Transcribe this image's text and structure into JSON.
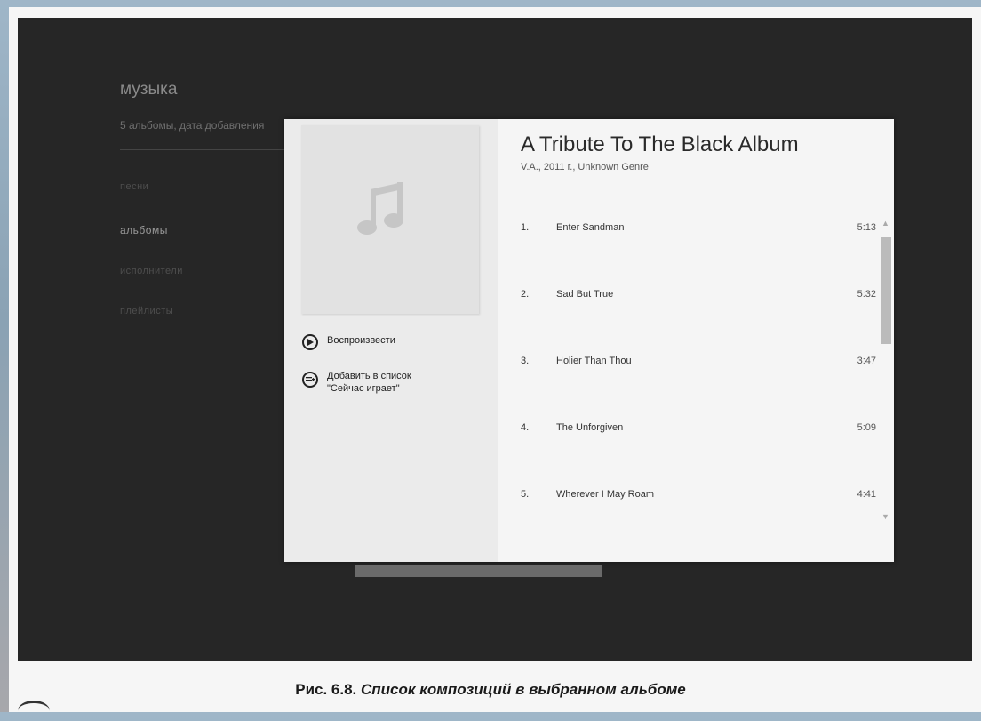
{
  "app": {
    "title": "музыка",
    "subtitle": "5 альбомы, дата добавления"
  },
  "nav": {
    "items": [
      {
        "label": "песни",
        "active": false
      },
      {
        "label": "альбомы",
        "active": true
      },
      {
        "label": "исполнители",
        "active": false
      },
      {
        "label": "плейлисты",
        "active": false
      }
    ]
  },
  "album": {
    "title": "A Tribute To The Black Album",
    "meta": "V.A., 2011 г., Unknown Genre",
    "art_icon": "music-note-icon",
    "actions": {
      "play": "Воспроизвести",
      "add_line1": "Добавить в список",
      "add_line2": "\"Сейчас играет\""
    },
    "tracks": [
      {
        "num": "1.",
        "name": "Enter Sandman",
        "duration": "5:13"
      },
      {
        "num": "2.",
        "name": "Sad But True",
        "duration": "5:32"
      },
      {
        "num": "3.",
        "name": "Holier Than Thou",
        "duration": "3:47"
      },
      {
        "num": "4.",
        "name": "The Unforgiven",
        "duration": "5:09"
      },
      {
        "num": "5.",
        "name": "Wherever I May Roam",
        "duration": "4:41"
      }
    ]
  },
  "caption": {
    "prefix": "Рис. 6.8.",
    "text": "Список композиций в выбранном альбоме"
  },
  "colors": {
    "screen_bg": "#262626",
    "dialog_bg": "#f5f5f5",
    "left_pane_bg": "#ebebeb"
  }
}
